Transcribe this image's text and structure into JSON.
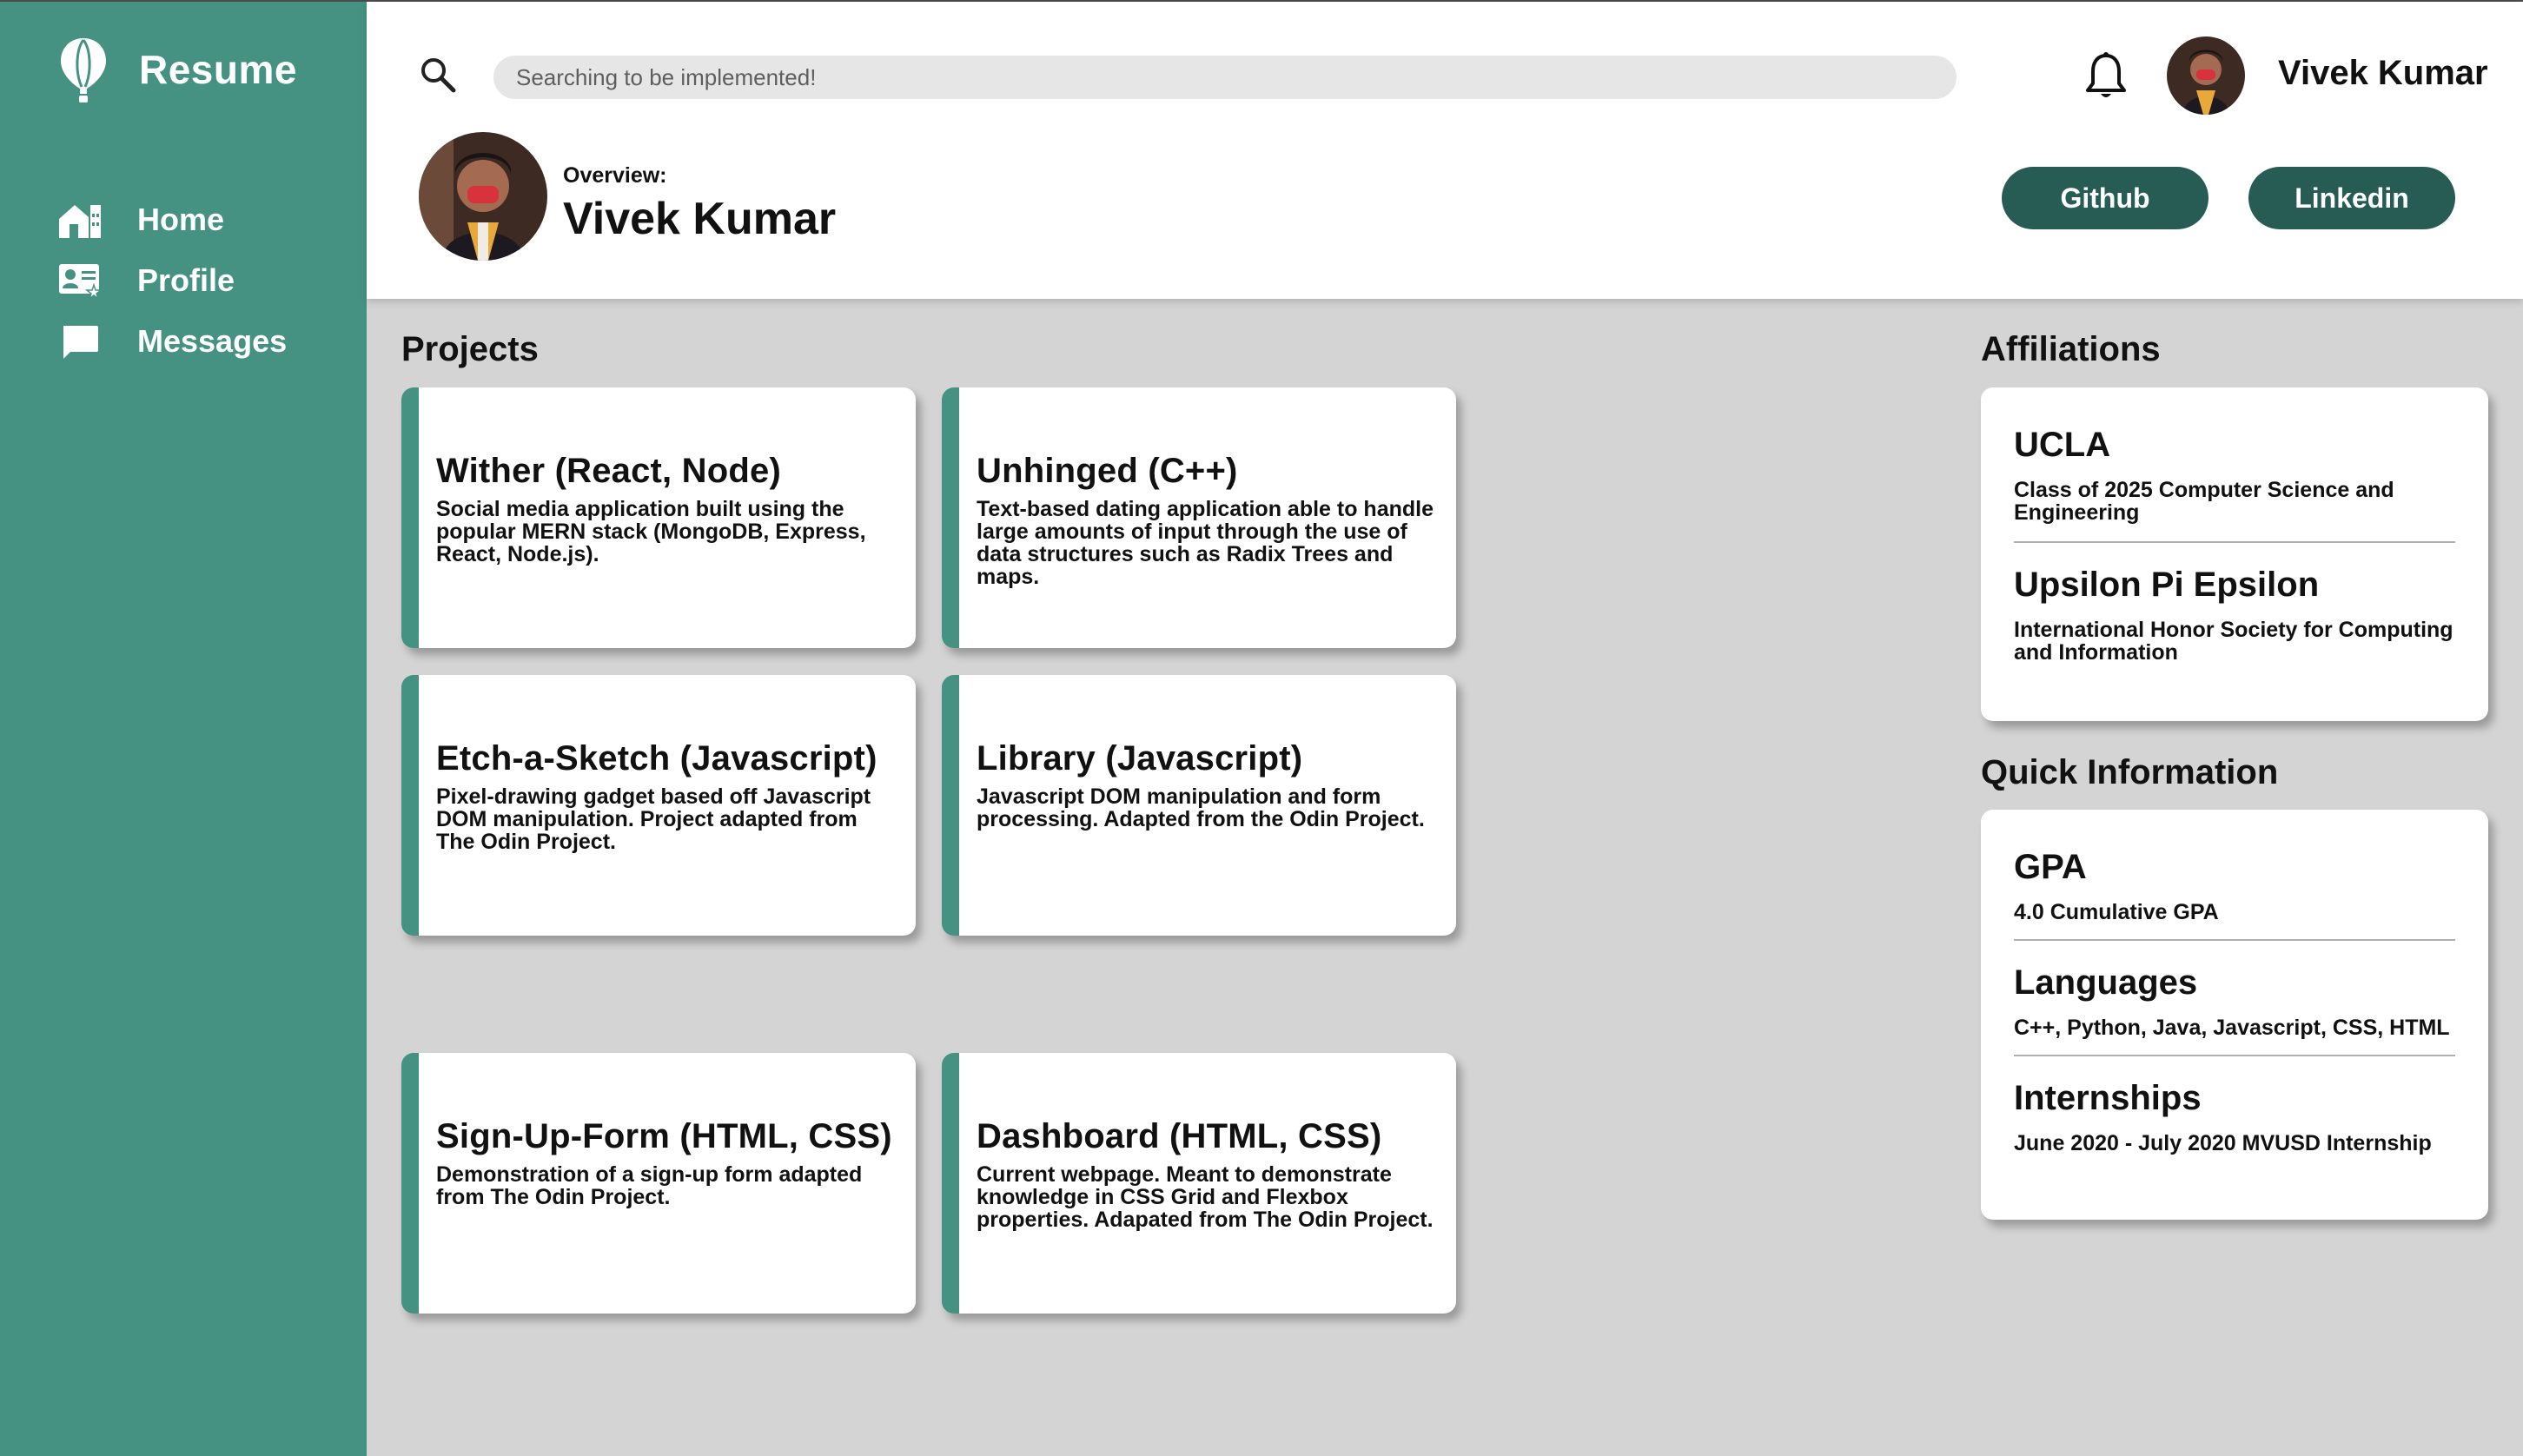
{
  "brand": {
    "name": "Resume",
    "icon": "balloon-icon"
  },
  "nav": {
    "items": [
      {
        "label": "Home",
        "icon": "home-icon"
      },
      {
        "label": "Profile",
        "icon": "profile-card-icon"
      },
      {
        "label": "Messages",
        "icon": "message-icon"
      }
    ]
  },
  "header": {
    "search_placeholder": "Searching to be implemented!",
    "user_name": "Vivek Kumar",
    "overview_label": "Overview:",
    "overview_name": "Vivek Kumar",
    "github_label": "Github",
    "linkedin_label": "Linkedin"
  },
  "projects": {
    "title": "Projects",
    "items": [
      {
        "title": "Wither (React, Node)",
        "desc": "Social media application built using the popular MERN stack (MongoDB, Express, React, Node.js)."
      },
      {
        "title": "Unhinged (C++)",
        "desc": "Text-based dating application able to handle large amounts of input through the use of data structures such as Radix Trees and maps."
      },
      {
        "title": "Etch-a-Sketch (Javascript)",
        "desc": "Pixel-drawing gadget based off Javascript DOM manipulation. Project adapted from The Odin Project."
      },
      {
        "title": "Library (Javascript)",
        "desc": "Javascript DOM manipulation and form processing. Adapted from the Odin Project."
      },
      {
        "title": "Sign-Up-Form (HTML, CSS)",
        "desc": "Demonstration of a sign-up form adapted from The Odin Project."
      },
      {
        "title": "Dashboard (HTML, CSS)",
        "desc": "Current webpage. Meant to demonstrate knowledge in CSS Grid and Flexbox properties. Adapated from The Odin Project."
      }
    ]
  },
  "affiliations": {
    "title": "Affiliations",
    "items": [
      {
        "title": "UCLA",
        "desc": "Class of 2025 Computer Science and Engineering"
      },
      {
        "title": "Upsilon Pi Epsilon",
        "desc": "International Honor Society for Computing and Information"
      }
    ]
  },
  "quick_info": {
    "title": "Quick Information",
    "items": [
      {
        "title": "GPA",
        "desc": "4.0 Cumulative GPA"
      },
      {
        "title": "Languages",
        "desc": "C++, Python, Java, Javascript, CSS, HTML"
      },
      {
        "title": "Internships",
        "desc": "June 2020 - July 2020 MVUSD Internship"
      }
    ]
  },
  "colors": {
    "accent": "#459283",
    "button": "#265c54",
    "background": "#d4d4d4"
  }
}
